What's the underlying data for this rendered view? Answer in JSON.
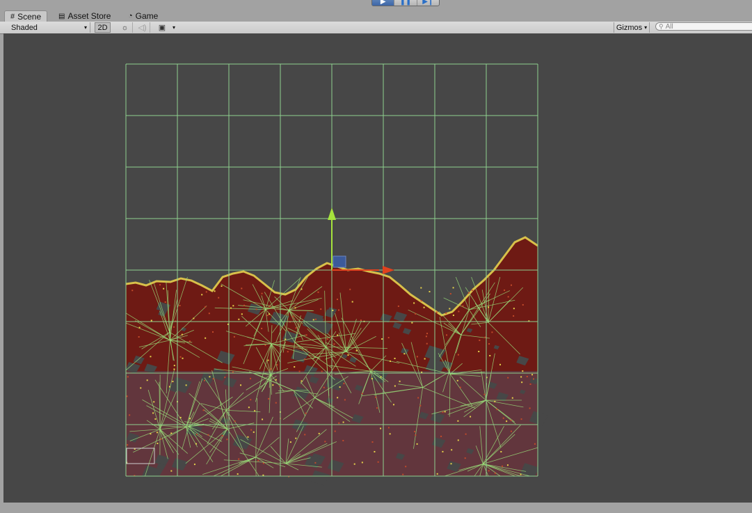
{
  "playbar": {
    "buttons": [
      "play-icon",
      "pause-icon",
      "step-icon"
    ]
  },
  "tabs": [
    {
      "label": "Scene",
      "icon": "grid-icon",
      "active": true
    },
    {
      "label": "Asset Store",
      "icon": "store-icon",
      "active": false
    },
    {
      "label": "Game",
      "icon": "pacman-icon",
      "active": false
    }
  ],
  "toolbar": {
    "shading_mode": "Shaded",
    "mode_2d": "2D",
    "gizmos_label": "Gizmos",
    "search_placeholder": "All"
  },
  "colors": {
    "viewport_bg": "#474747",
    "grid_line": "#8fd08f",
    "terrain_fill": "#6e1a14",
    "terrain_edge": "#d8c04a",
    "mesh_line": "#9ae07a",
    "axis_y": "#a6e43c",
    "axis_x": "#e0421e",
    "pivot": "#3c5a9a"
  }
}
